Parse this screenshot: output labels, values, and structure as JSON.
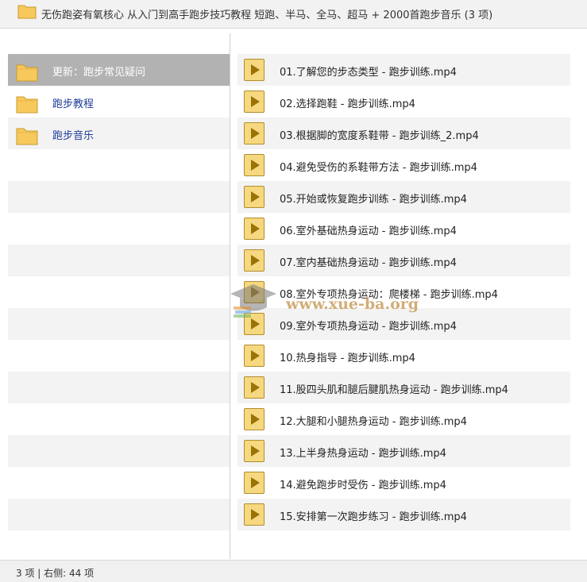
{
  "window": {
    "title": "无伤跑姿有氧核心 从入门到高手跑步技巧教程 短跑、半马、全马、超马 + 2000首跑步音乐 (3 项)",
    "icon": "folder-icon"
  },
  "left_pane": {
    "items": [
      {
        "label": "更新：跑步常见疑问",
        "icon": "folder-icon",
        "selected": true
      },
      {
        "label": "跑步教程",
        "icon": "folder-icon"
      },
      {
        "label": "跑步音乐",
        "icon": "folder-icon"
      }
    ]
  },
  "right_pane": {
    "files": [
      {
        "label": "01.了解您的步态类型 - 跑步训练.mp4",
        "icon": "media-file-icon"
      },
      {
        "label": "02.选择跑鞋 - 跑步训练.mp4",
        "icon": "media-file-icon"
      },
      {
        "label": "03.根据脚的宽度系鞋带 - 跑步训练_2.mp4",
        "icon": "media-file-icon"
      },
      {
        "label": "04.避免受伤的系鞋带方法 - 跑步训练.mp4",
        "icon": "media-file-icon"
      },
      {
        "label": "05.开始或恢复跑步训练 - 跑步训练.mp4",
        "icon": "media-file-icon"
      },
      {
        "label": "06.室外基础热身运动 - 跑步训练.mp4",
        "icon": "media-file-icon"
      },
      {
        "label": "07.室内基础热身运动 - 跑步训练.mp4",
        "icon": "media-file-icon"
      },
      {
        "label": "08.室外专项热身运动：爬楼梯 - 跑步训练.mp4",
        "icon": "media-file-icon"
      },
      {
        "label": "09.室外专项热身运动 - 跑步训练.mp4",
        "icon": "media-file-icon"
      },
      {
        "label": "10.热身指导 - 跑步训练.mp4",
        "icon": "media-file-icon"
      },
      {
        "label": "11.股四头肌和腿后腱肌热身运动 - 跑步训练.mp4",
        "icon": "media-file-icon"
      },
      {
        "label": "12.大腿和小腿热身运动 - 跑步训练.mp4",
        "icon": "media-file-icon"
      },
      {
        "label": "13.上半身热身运动 - 跑步训练.mp4",
        "icon": "media-file-icon"
      },
      {
        "label": "14.避免跑步时受伤 - 跑步训练.mp4",
        "icon": "media-file-icon"
      },
      {
        "label": "15.安排第一次跑步练习 - 跑步训练.mp4",
        "icon": "media-file-icon"
      }
    ]
  },
  "watermark": {
    "text": "www.xue-ba.org",
    "icon": "graduation-cap-logo"
  },
  "status": {
    "text": "3 项 | 右侧: 44 项"
  }
}
